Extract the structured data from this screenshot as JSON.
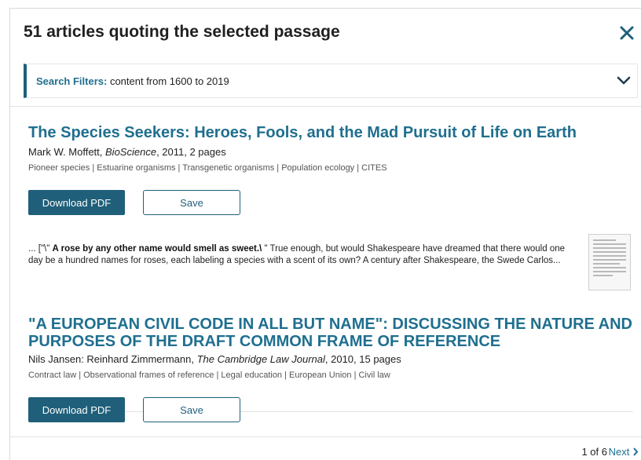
{
  "header": {
    "title": "51 articles quoting the selected passage",
    "close_icon": "close-icon"
  },
  "filters": {
    "label": "Search Filters:",
    "value": " content from 1600 to 2019",
    "chevron_icon": "chevron-down-icon"
  },
  "articles": [
    {
      "title": "The Species Seekers: Heroes, Fools, and the Mad Pursuit of Life on Earth",
      "authors": "Mark W. Moffett, ",
      "journal": "BioScience",
      "details": ", 2011, 2 pages",
      "topics": "Pioneer species | Estuarine organisms | Transgenetic organisms | Population ecology | CITES",
      "download_label": "Download PDF",
      "save_label": "Save",
      "snippet_pre": "... [\"\\\" ",
      "snippet_bold": "A rose by any other name would smell as sweet.\\",
      "snippet_post": " \" True enough, but would Shakespeare have dreamed that there would one day be a hundred names for roses, each labeling a species with a scent of its own? A century after Shakespeare, the Swede Carlos..."
    },
    {
      "title_line1": "\"A EUROPEAN CIVIL CODE IN ALL BUT NAME\": DISCUSSING THE NATURE AND",
      "title_line2": "PURPOSES OF THE DRAFT COMMON FRAME OF REFERENCE",
      "authors": "Nils Jansen: Reinhard Zimmermann, ",
      "journal": "The Cambridge Law Journal",
      "details": ", 2010, 15 pages",
      "topics": "Contract law | Observational frames of reference | Legal education | European Union | Civil law",
      "download_label": "Download PDF",
      "save_label": "Save"
    }
  ],
  "pagination": {
    "page_info": "1 of 6",
    "next_label": "Next"
  },
  "colors": {
    "accent": "#1f5f7a",
    "link": "#1f6f8f"
  }
}
